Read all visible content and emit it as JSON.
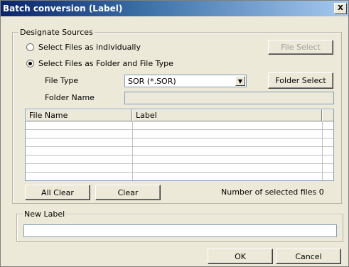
{
  "window": {
    "title": "Batch conversion (Label)",
    "close_label": "X"
  },
  "sources": {
    "legend": "Designate Sources",
    "radio_individual": "Select Files as individually",
    "radio_folder": "Select Files as Folder and File Type",
    "file_select_label": "File Select",
    "file_type_label": "File Type",
    "file_type_value": "SOR (*.SOR)",
    "folder_select_label": "Folder Select",
    "folder_name_label": "Folder Name",
    "folder_name_value": ""
  },
  "table": {
    "columns": [
      "File Name",
      "Label"
    ],
    "rows": []
  },
  "actions": {
    "all_clear": "All Clear",
    "clear": "Clear",
    "count_text": "Number of selected files 0"
  },
  "new_label": {
    "legend": "New Label",
    "value": ""
  },
  "footer": {
    "ok": "OK",
    "cancel": "Cancel"
  }
}
